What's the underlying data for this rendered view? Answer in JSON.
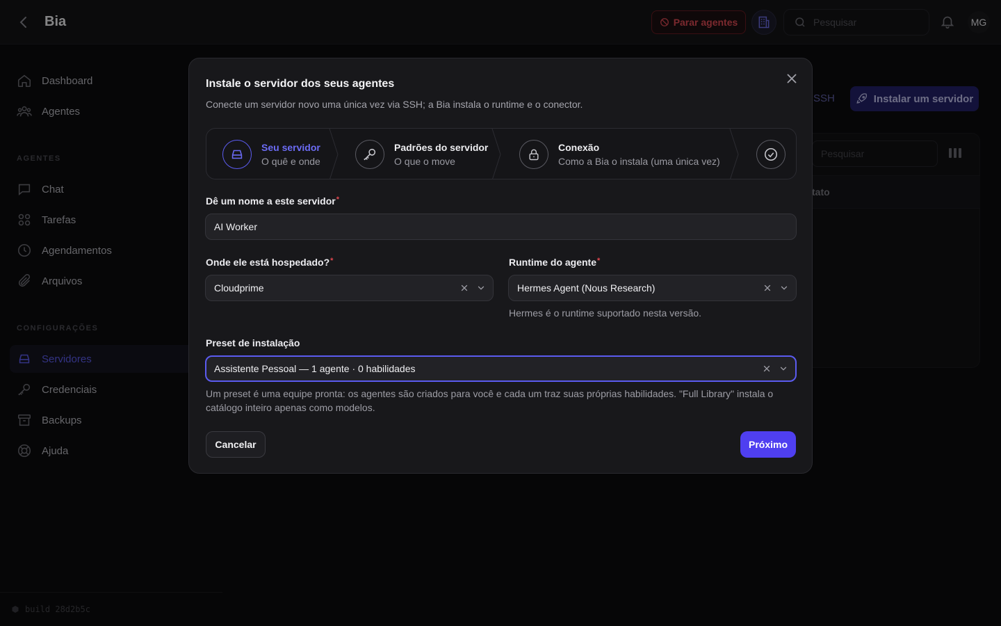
{
  "topbar": {
    "app_title": "Bia",
    "stop_agents_label": "Parar agentes",
    "search_placeholder": "Pesquisar",
    "avatar_initials": "MG"
  },
  "sidebar": {
    "items_top": [
      {
        "label": "Dashboard",
        "icon": "home-icon"
      },
      {
        "label": "Agentes",
        "icon": "users-icon"
      }
    ],
    "section_agents": "AGENTES",
    "items_agents": [
      {
        "label": "Chat",
        "icon": "chat-icon"
      },
      {
        "label": "Tarefas",
        "icon": "grid-icon"
      },
      {
        "label": "Agendamentos",
        "icon": "clock-icon"
      },
      {
        "label": "Arquivos",
        "icon": "paperclip-icon"
      }
    ],
    "section_config": "CONFIGURAÇÕES",
    "items_config": [
      {
        "label": "Servidores",
        "icon": "server-icon",
        "active": true
      },
      {
        "label": "Credenciais",
        "icon": "key-icon"
      },
      {
        "label": "Backups",
        "icon": "archive-icon"
      },
      {
        "label": "Ajuda",
        "icon": "lifebuoy-icon"
      }
    ],
    "build_label": "build 28d2b5c"
  },
  "background": {
    "ssh_link_fragment": "es SSH",
    "install_button": "Instalar um servidor",
    "search_placeholder": "Pesquisar",
    "column_header_fragment": "tato"
  },
  "modal": {
    "title": "Instale o servidor dos seus agentes",
    "subtitle": "Conecte um servidor novo uma única vez via SSH; a Bia instala o runtime e o conector.",
    "steps": [
      {
        "title": "Seu servidor",
        "desc": "O quê e onde",
        "icon": "server-icon",
        "active": true
      },
      {
        "title": "Padrões do servidor",
        "desc": "O que o move",
        "icon": "key-icon",
        "active": false
      },
      {
        "title": "Conexão",
        "desc": "Como a Bia o instala (uma única vez)",
        "icon": "lock-icon",
        "active": false
      },
      {
        "title": "",
        "desc": "",
        "icon": "check-circle-icon",
        "active": false
      }
    ],
    "name_field": {
      "label": "Dê um nome a este servidor",
      "value": "AI Worker"
    },
    "host_field": {
      "label": "Onde ele está hospedado?",
      "value": "Cloudprime"
    },
    "runtime_field": {
      "label": "Runtime do agente",
      "value": "Hermes Agent (Nous Research)",
      "help": "Hermes é o runtime suportado nesta versão."
    },
    "preset_field": {
      "label": "Preset de instalação",
      "value": "Assistente Pessoal — 1 agente · 0 habilidades",
      "help_line1": "Um preset é uma equipe pronta: os agentes são criados para você e cada um traz suas próprias habilidades. \"Full Library\" instala o",
      "help_line2": "catálogo inteiro apenas como modelos."
    },
    "cancel_label": "Cancelar",
    "next_label": "Próximo"
  },
  "colors": {
    "accent": "#4f3ff0",
    "accent_text": "#6c6cf5",
    "danger": "#e04b55",
    "required": "#e0474f"
  }
}
